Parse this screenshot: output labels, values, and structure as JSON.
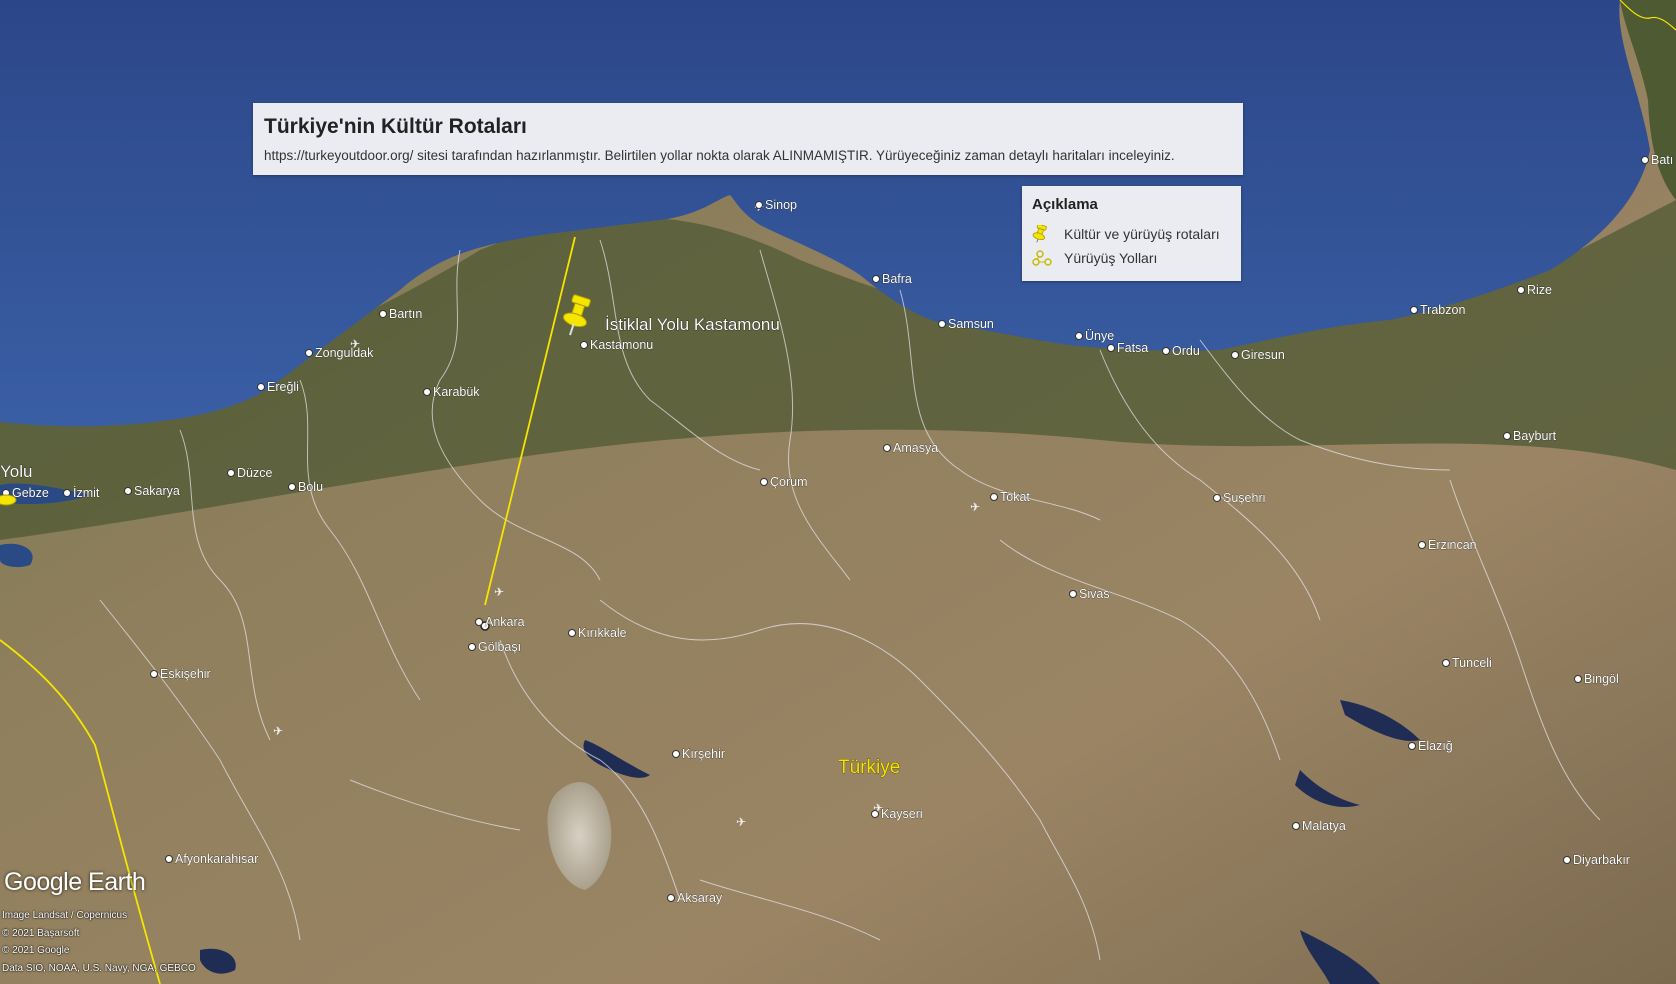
{
  "title_panel": {
    "title": "Türkiye'nin Kültür Rotaları",
    "description": "https://turkeyoutdoor.org/ sitesi tarafından hazırlanmıştır. Belirtilen yollar nokta olarak ALINMAMIŞTIR. Yürüyeceğiniz zaman detaylı haritaları inceleyiniz."
  },
  "legend": {
    "title": "Açıklama",
    "items": [
      {
        "label": "Kültür ve yürüyüş rotaları",
        "icon": "pushpin-icon"
      },
      {
        "label": "Yürüyüş Yolları",
        "icon": "path-icon"
      }
    ]
  },
  "placemark": {
    "label": "İstiklal Yolu Kastamonu",
    "color": "#f5e500"
  },
  "partial_label": "Yolu",
  "country_label": "Türkiye",
  "cities": [
    "Sinop",
    "Bafra",
    "Samsun",
    "Ünye",
    "Fatsa",
    "Ordu",
    "Giresun",
    "Trabzon",
    "Rize",
    "Batı",
    "Bartın",
    "Zonguldak",
    "Ereğli",
    "Karabük",
    "Kastamonu",
    "Düzce",
    "Bolu",
    "Sakarya",
    "İzmit",
    "Gebze",
    "Amasya",
    "Çorum",
    "Tokat",
    "Suşehri",
    "Bayburt",
    "Erzincan",
    "Sivas",
    "Ankara",
    "Gölbaşı",
    "Kırıkkale",
    "Eskişehir",
    "Kırşehir",
    "Kayseri",
    "Tunceli",
    "Bingöl",
    "Elazığ",
    "Malatya",
    "Diyarbakır",
    "Afyonkarahisar",
    "Aksaray"
  ],
  "branding": {
    "logo": "Google Earth"
  },
  "credits": [
    "Image Landsat / Copernicus",
    "© 2021 Başarsoft",
    "© 2021 Google",
    "Data SIO, NOAA, U.S. Navy, NGA, GEBCO"
  ],
  "colors": {
    "sea": "#2b4a8c",
    "land": "#8b7d5c",
    "route": "#f5e500",
    "panel": "#f2f2f6"
  }
}
